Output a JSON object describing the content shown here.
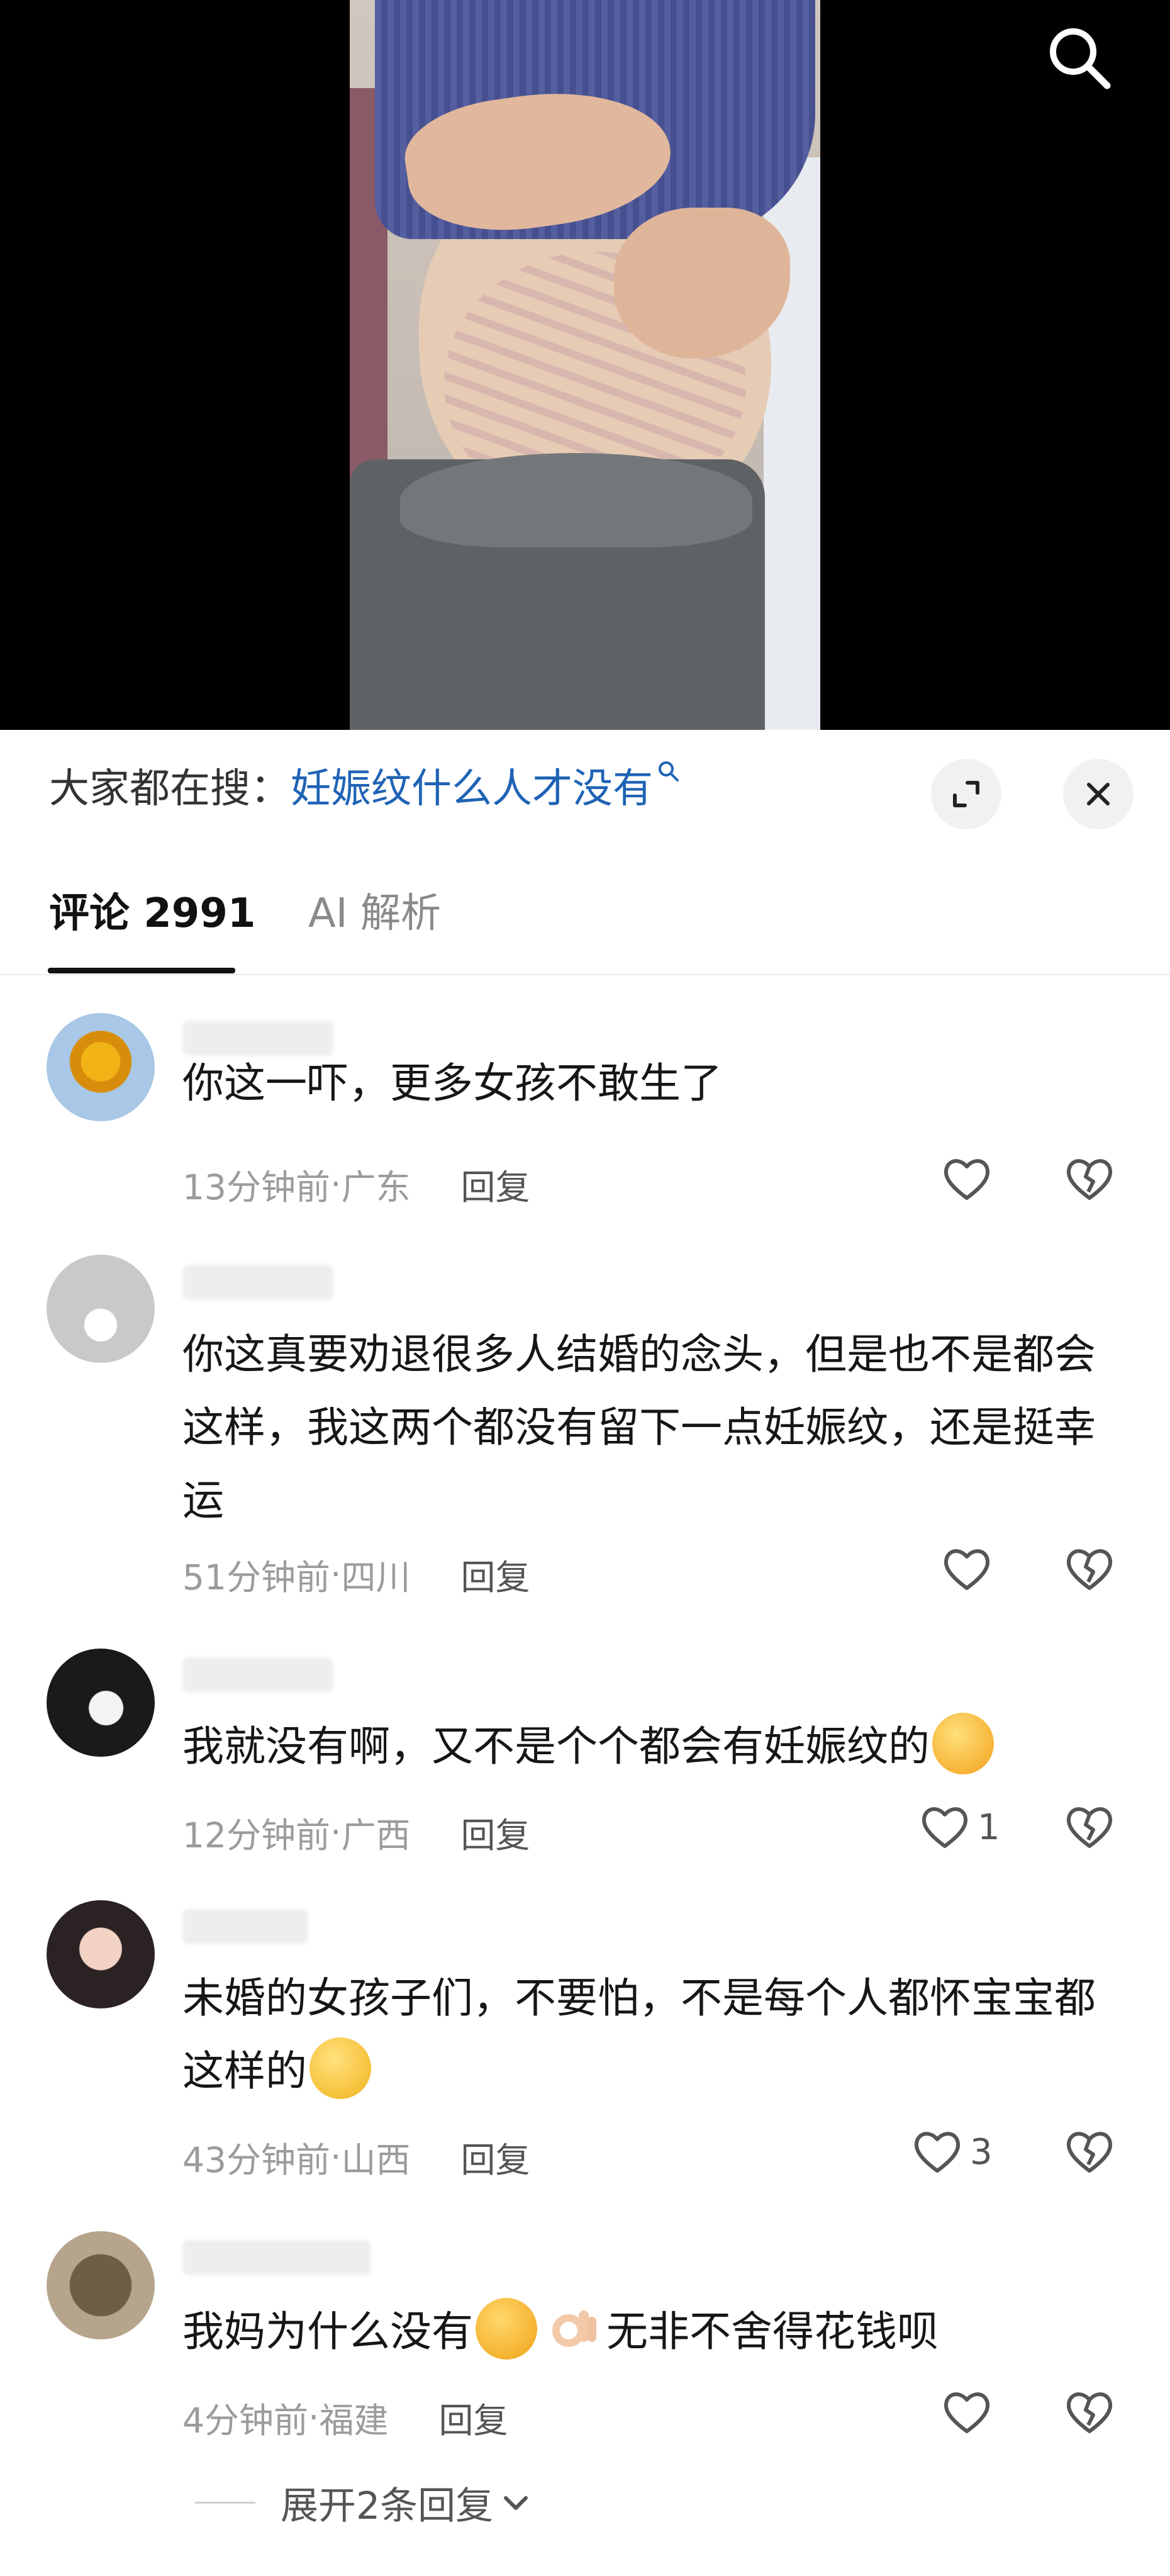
{
  "video": {
    "search_icon": "search-icon"
  },
  "sheet": {
    "suggest_prefix": "大家都在搜：",
    "suggest_query": "妊娠纹什么人才没有",
    "expand_icon": "expand-icon",
    "close_icon": "close-icon"
  },
  "tabs": {
    "comments": "评论 2991",
    "ai": "AI 解析"
  },
  "comments": [
    {
      "text": "你这一吓，更多女孩不敢生了",
      "time": "13分钟前",
      "location": "广东",
      "reply": "回复",
      "likes": ""
    },
    {
      "text": "你这真要劝退很多人结婚的念头，但是也不是都会这样，我这两个都没有留下一点妊娠纹，还是挺幸运",
      "time": "51分钟前",
      "location": "四川",
      "reply": "回复",
      "likes": ""
    },
    {
      "text": "我就没有啊，又不是个个都会有妊娠纹的",
      "time": "12分钟前",
      "location": "广西",
      "reply": "回复",
      "likes": "1"
    },
    {
      "text": "未婚的女孩子们，不要怕，不是每个人都怀宝宝都这样的",
      "time": "43分钟前",
      "location": "山西",
      "reply": "回复",
      "likes": "3"
    },
    {
      "text_a": "我妈为什么没有",
      "text_b": "无非不舍得花钱呗",
      "time": "4分钟前",
      "location": "福建",
      "reply": "回复",
      "likes": ""
    }
  ],
  "expand_replies": "展开2条回复",
  "meta_separator": " · "
}
